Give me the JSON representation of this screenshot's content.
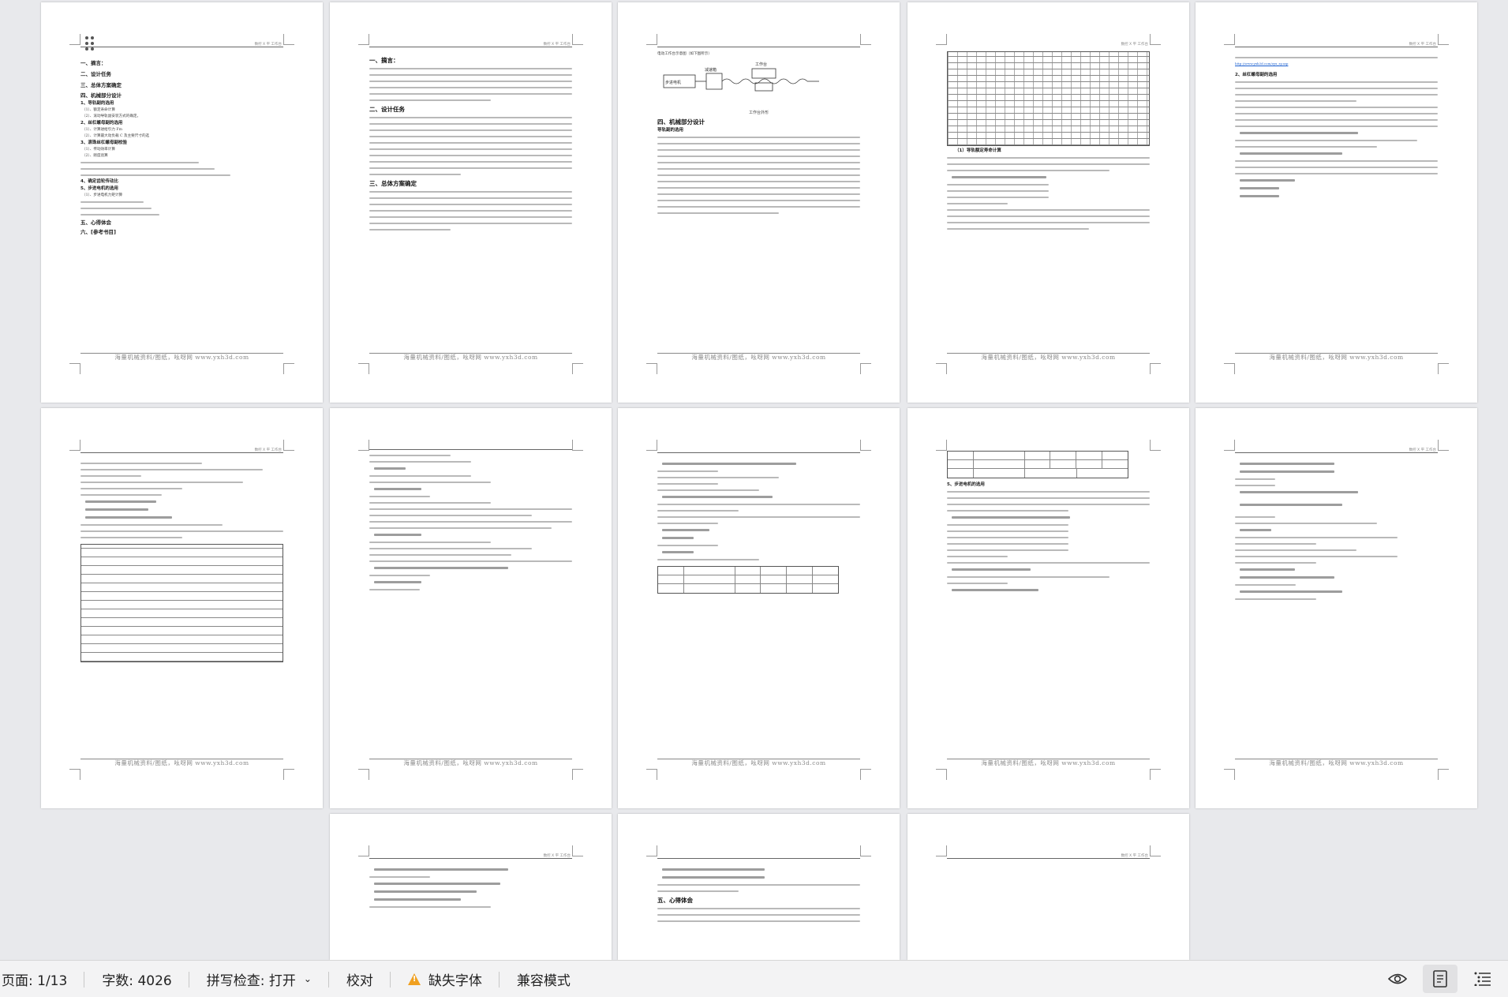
{
  "document": {
    "page_header": "数控 X 平 工作台",
    "page_footer": "海量机械资料/图纸，吆呀网 www.yxh3d.com",
    "toc": {
      "items": [
        "一、摘言：",
        "二、设计任务",
        "三、总体方案确定",
        "四、机械部分设计",
        "五、心得体会",
        "六、[参考书目]"
      ],
      "sub_items": [
        "1、导轨副的选用",
        "（1）、额定寿命计算",
        "（2）、滚动导轨副安装方式的确定。",
        "2、丝杠螺母副的选用",
        "（1）、计算进给引力 Fm",
        "（2）、计算最大动负载 C 及主要尺寸的选",
        "3、滚珠丝杠螺母副校验",
        "（1）、传动效率计算",
        "（2）、刚度验算",
        "4、确定齿轮传动比",
        "5、步进电机的选用",
        "（1）、步进电机力矩计算"
      ]
    },
    "intro_page": {
      "headings": [
        "一、摘言：",
        "二、设计任务",
        "三、总体方案确定"
      ]
    },
    "diagram_page": {
      "caption_top": "电动工作台示意图（如下图所示）",
      "motor_label": "步进电机",
      "gearbox_label": "减速箱",
      "table_label": "工作台",
      "caption": "工作台外形",
      "headings": [
        "四、机械部分设计"
      ],
      "subheading": "导轨副的选用"
    },
    "ball_screw_page": {
      "subheading": "（1）导轨额定寿命计算"
    },
    "right_top_page": {
      "link": "http://www.yxh3d.com/zyx_zy.asp",
      "subheading": "2、丝杠螺母副的选用"
    },
    "motor_page": {
      "subheading": "5、步进电机的选用"
    },
    "last_page": {
      "heading": "五、心得体会"
    }
  },
  "statusbar": {
    "page": "页面: 1/13",
    "word_count": "字数: 4026",
    "spell_check": "拼写检查: 打开",
    "proofread": "校对",
    "missing_font": "缺失字体",
    "compat_mode": "兼容模式"
  },
  "colors": {
    "background": "#e8e9ec",
    "page": "#ffffff",
    "statusbar": "#f3f3f4",
    "warning": "#f0a020"
  },
  "icons": [
    "drag-handle-icon",
    "warning-icon",
    "chevron-down-icon",
    "eye-icon",
    "page-view-icon",
    "outline-view-icon"
  ]
}
